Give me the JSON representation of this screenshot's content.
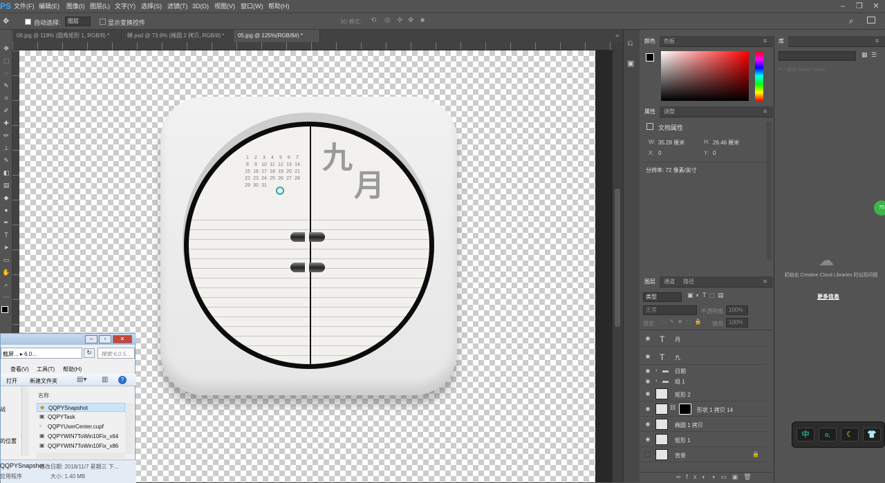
{
  "app": {
    "logo": "PS"
  },
  "menu": [
    "文件(F)",
    "编辑(E)",
    "图像(I)",
    "图层(L)",
    "文字(Y)",
    "选择(S)",
    "滤镜(T)",
    "3D(D)",
    "视图(V)",
    "窗口(W)",
    "帮助(H)"
  ],
  "options": {
    "auto_select_label": "自动选择:",
    "auto_select_value": "图层",
    "show_transform_label": "显示变换控件",
    "mode3d_label": "3D 模式:"
  },
  "tabs": [
    "06.jpg @ 118% (圆角矩形 1, RGB/8) *",
    "蝉.psd @ 73.9% (椭圆 2 拷贝, RGB/8) *",
    "05.jpg @ 125%(RGB/8#) *"
  ],
  "artwork": {
    "calendar": [
      "1",
      "2",
      "3",
      "4",
      "5",
      "6",
      "7",
      "8",
      "9",
      "10",
      "11",
      "12",
      "13",
      "14",
      "15",
      "16",
      "17",
      "18",
      "19",
      "20",
      "21",
      "22",
      "23",
      "24",
      "25",
      "26",
      "27",
      "28",
      "29",
      "30",
      "31"
    ],
    "char1": "九",
    "char2": "月"
  },
  "color_panel": {
    "tabs": [
      "颜色",
      "色板"
    ]
  },
  "properties": {
    "tabs": [
      "属性",
      "调整"
    ],
    "title": "文档属性",
    "w_label": "W:",
    "w_value": "35.28 厘米",
    "h_label": "H:",
    "h_value": "26.46 厘米",
    "x_label": "X:",
    "x_value": "0",
    "y_label": "Y:",
    "y_value": "0",
    "resolution": "分辨率: 72 像素/英寸"
  },
  "layers_panel": {
    "tabs": [
      "图层",
      "通道",
      "路径"
    ],
    "filter": "类型",
    "blend": "正常",
    "opacity_label": "不透明度:",
    "opacity": "100%",
    "lock_label": "锁定:",
    "fill_label": "填充:",
    "fill": "100%",
    "layers": [
      "月",
      "九",
      "日期",
      "组 1",
      "矩形 2",
      "形状 1 拷贝 14",
      "椭圆 1 拷贝",
      "矩形 1",
      "背景"
    ]
  },
  "library": {
    "tab": "库",
    "search_placeholder": "搜索 Adobe Stock",
    "cloud_message": "初始化 Creative Cloud Libraries 时出现问题",
    "more_info": "更多信息"
  },
  "explorer": {
    "path": "截屏... ▸ 6.0...",
    "search_placeholder": "搜索 6.0.5...",
    "menu": [
      "查看(V)",
      "工具(T)",
      "帮助(H)"
    ],
    "toolbar": [
      "打开",
      "新建文件夹"
    ],
    "col_name": "名称",
    "left_items": [
      "战",
      "的位置"
    ],
    "files": [
      "QQPYSnapshot",
      "QQPYTask",
      "QQPYUserCenter.cupf",
      "QQPYWIN7ToWin10Fix_x64",
      "QQPYWIN7ToWin10Fix_x86"
    ],
    "status_name": "QQPYSnapshot",
    "status_date": "修改日期: 2018/11/7 星期三 下...",
    "status_type": "应用程序",
    "status_size": "大小: 1.40 MB"
  },
  "ime": {
    "buttons": [
      "中",
      "o,",
      "☾",
      "👕"
    ],
    "badge": "75"
  }
}
